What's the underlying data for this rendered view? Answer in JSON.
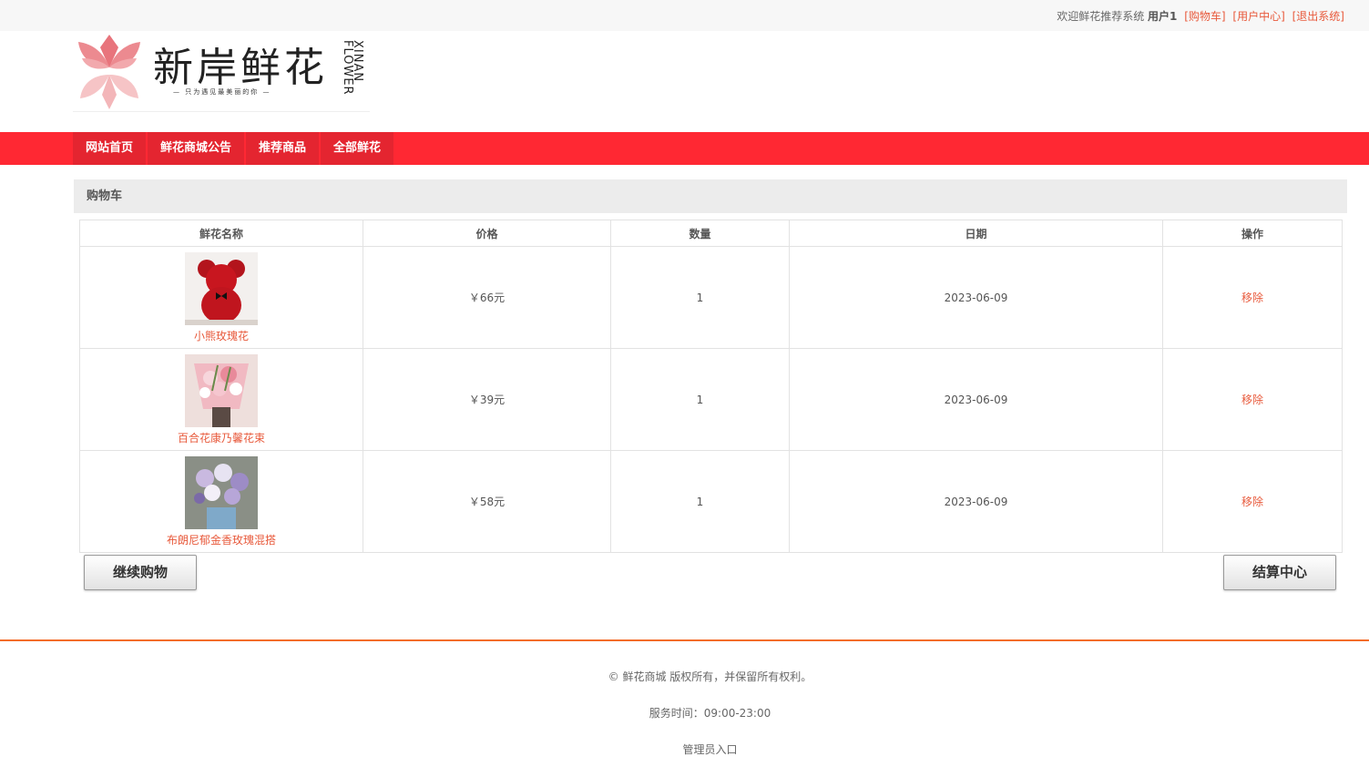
{
  "topbar": {
    "welcome": "欢迎鲜花推荐系统",
    "user": "用户1",
    "links": [
      "[购物车]",
      "[用户中心]",
      "[退出系统]"
    ]
  },
  "logo": {
    "title_cn": "新岸鲜花",
    "title_en": "XINAN FLOWER",
    "tagline": "— 只为遇见最美丽的你 —"
  },
  "nav": {
    "items": [
      "网站首页",
      "鲜花商城公告",
      "推荐商品",
      "全部鲜花"
    ]
  },
  "cart": {
    "title": "购物车",
    "columns": [
      "鲜花名称",
      "价格",
      "数量",
      "日期",
      "操作"
    ],
    "rows": [
      {
        "name": "小熊玫瑰花",
        "price": "￥66元",
        "qty": "1",
        "date": "2023-06-09",
        "action": "移除"
      },
      {
        "name": "百合花康乃馨花束",
        "price": "￥39元",
        "qty": "1",
        "date": "2023-06-09",
        "action": "移除"
      },
      {
        "name": "布朗尼郁金香玫瑰混搭",
        "price": "￥58元",
        "qty": "1",
        "date": "2023-06-09",
        "action": "移除"
      }
    ]
  },
  "buttons": {
    "continue": "继续购物",
    "checkout": "结算中心"
  },
  "footer": {
    "copyright": "© 鲜花商城 版权所有，并保留所有权利。",
    "hours": "服务时间：09:00-23:00",
    "admin": "管理员入口"
  },
  "colors": {
    "accent": "#ff2833",
    "link": "#e85a3c",
    "footer_line": "#f36c2a"
  }
}
